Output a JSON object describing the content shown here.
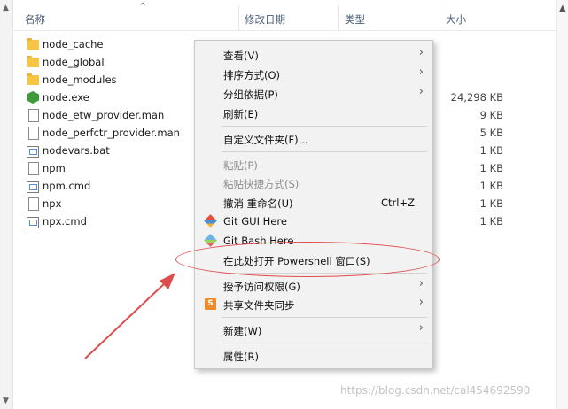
{
  "columns": {
    "name": "名称",
    "date": "修改日期",
    "type": "类型",
    "size": "大小"
  },
  "files": [
    {
      "name": "node_cache",
      "size": "",
      "icon": "folder-icon"
    },
    {
      "name": "node_global",
      "size": "",
      "icon": "folder-icon"
    },
    {
      "name": "node_modules",
      "size": "",
      "icon": "folder-icon"
    },
    {
      "name": "node.exe",
      "size": "24,298 KB",
      "icon": "nodejs-icon"
    },
    {
      "name": "node_etw_provider.man",
      "size": "9 KB",
      "icon": "document-icon"
    },
    {
      "name": "node_perfctr_provider.man",
      "size": "5 KB",
      "icon": "document-icon"
    },
    {
      "name": "nodevars.bat",
      "size": "1 KB",
      "icon": "batch-icon"
    },
    {
      "name": "npm",
      "size": "1 KB",
      "icon": "document-icon"
    },
    {
      "name": "npm.cmd",
      "size": "1 KB",
      "icon": "batch-icon"
    },
    {
      "name": "npx",
      "size": "1 KB",
      "icon": "document-icon"
    },
    {
      "name": "npx.cmd",
      "size": "1 KB",
      "icon": "batch-icon"
    }
  ],
  "menu": {
    "view": "查看(V)",
    "sort": "排序方式(O)",
    "group": "分组依据(P)",
    "refresh": "刷新(E)",
    "customize": "自定义文件夹(F)...",
    "paste": "粘贴(P)",
    "paste_shortcut": "粘贴快捷方式(S)",
    "undo": "撤消 重命名(U)",
    "undo_shortcut": "Ctrl+Z",
    "git_gui": "Git GUI Here",
    "git_bash": "Git Bash Here",
    "powershell": "在此处打开 Powershell 窗口(S)",
    "give_access": "授予访问权限(G)",
    "share_sync": "共享文件夹同步",
    "new": "新建(W)",
    "properties": "属性(R)"
  },
  "accent_colors": {
    "annotation": "#e04b4b",
    "folder": "#f6c544"
  },
  "watermark": "https://blog.csdn.net/cal454692590"
}
